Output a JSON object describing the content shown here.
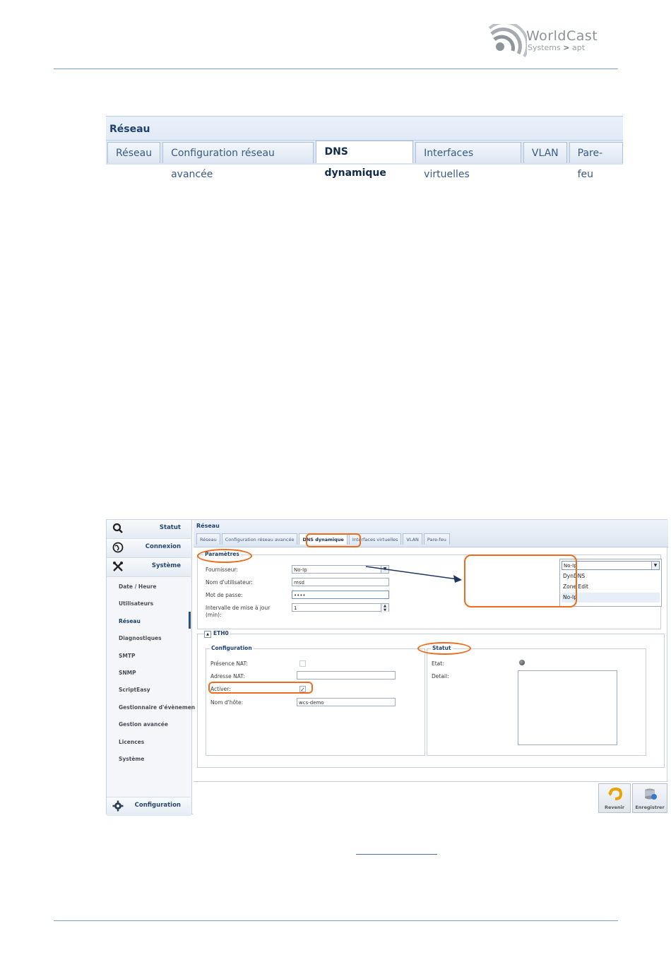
{
  "logo": {
    "word": "WorldCast",
    "sub_left": "Systems",
    "sub_sep": ">",
    "sub_right": "apt"
  },
  "top_tabbar": {
    "title": "Réseau",
    "tabs": [
      "Réseau",
      "Configuration réseau avancée",
      "DNS dynamique",
      "Interfaces virtuelles",
      "VLAN",
      "Pare-feu"
    ],
    "active_tab": "DNS dynamique"
  },
  "sidebar": {
    "categories": [
      {
        "icon": "search-icon",
        "label": "Statut"
      },
      {
        "icon": "globe-icon",
        "label": "Connexion"
      },
      {
        "icon": "tools-icon",
        "label": "Système"
      }
    ],
    "items": [
      "Date / Heure",
      "Utilisateurs",
      "Réseau",
      "Diagnostiques",
      "SMTP",
      "SNMP",
      "ScriptEasy",
      "Gestionnaire d'évènemen",
      "Gestion avancée",
      "Licences",
      "Système"
    ],
    "active_item": "Réseau",
    "footer": {
      "icon": "gear-icon",
      "label": "Configuration"
    }
  },
  "main": {
    "title": "Réseau",
    "tabs": [
      "Réseau",
      "Configuration réseau avancée",
      "DNS dynamique",
      "Interfaces virtuelles",
      "VLAN",
      "Pare-feu"
    ],
    "active_tab": "DNS dynamique",
    "params": {
      "legend": "Paramètres",
      "provider_label": "Fournisseur:",
      "provider_value": "No-Ip",
      "username_label": "Nom d'utilisateur:",
      "username_value": "msd",
      "password_label": "Mot de passe:",
      "password_value": "••••",
      "interval_label_1": "Intervalle de mise à jour",
      "interval_label_2": "(min):",
      "interval_value": "1"
    },
    "provider_dropdown": {
      "selected": "No-Ip",
      "options": [
        "DynDNS",
        "Zone Edit",
        "No-Ip"
      ],
      "highlighted": "No-Ip"
    },
    "eth": {
      "title": "ETH0",
      "config": {
        "legend": "Configuration",
        "nat_presence_label": "Présence NAT:",
        "nat_presence_checked": false,
        "nat_address_label": "Adresse NAT:",
        "nat_address_value": "",
        "enable_label": "Activer:",
        "enable_checked": true,
        "enable_mark": "✓",
        "hostname_label": "Nom d'hôte:",
        "hostname_value": "wcs-demo"
      },
      "status": {
        "legend": "Statut",
        "state_label": "Etat:",
        "detail_label": "Detail:"
      }
    },
    "actions": [
      {
        "icon": "undo-icon",
        "label": "Revenir"
      },
      {
        "icon": "save-database-icon",
        "label": "Enregistrer"
      }
    ]
  },
  "colors": {
    "annotation": "#ee6b1e",
    "arrow": "#1f3560",
    "header_blue": "#1f3f6e"
  }
}
